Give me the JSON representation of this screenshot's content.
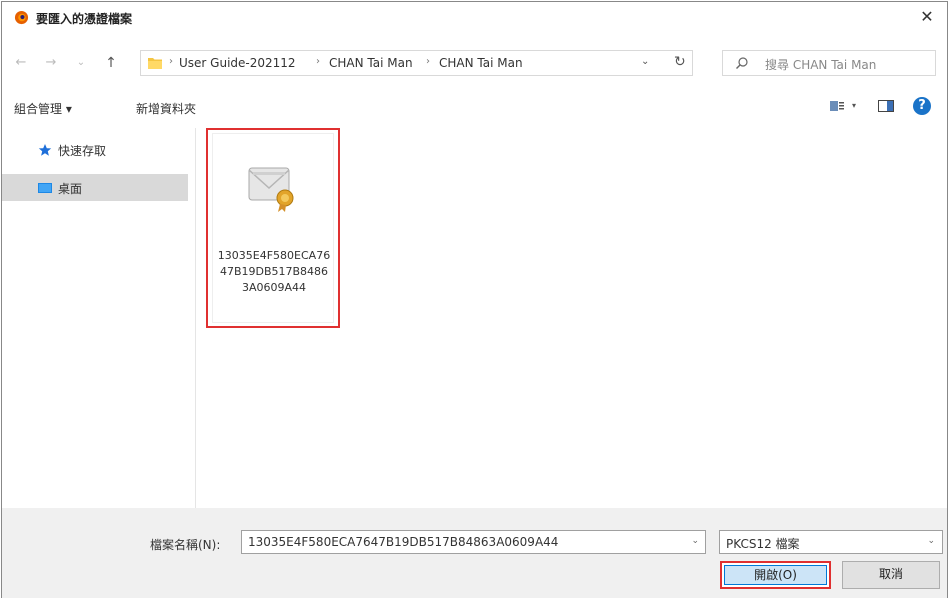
{
  "window": {
    "title": "要匯入的憑證檔案",
    "close_glyph": "✕"
  },
  "nav": {
    "back_glyph": "←",
    "forward_glyph": "→",
    "recent_glyph": "⌄",
    "up_glyph": "↑",
    "breadcrumbs": [
      "User Guide-202112",
      "CHAN Tai Man",
      "CHAN Tai Man"
    ],
    "separator": "›",
    "address_dropdown_glyph": "⌄",
    "refresh_glyph": "↻",
    "search_placeholder": "搜尋 CHAN Tai Man"
  },
  "toolbar": {
    "organize_label": "組合管理 ▾",
    "new_folder_label": "新增資料夾",
    "view_dropdown_glyph": "▾",
    "help_glyph": "?"
  },
  "sidebar": {
    "items": [
      {
        "label": "快速存取",
        "icon": "star-icon"
      },
      {
        "label": "桌面",
        "icon": "desktop-icon"
      }
    ]
  },
  "files": [
    {
      "name": "13035E4F580ECA7647B19DB517B84863A0609A44",
      "icon": "certificate-icon"
    }
  ],
  "bottom": {
    "filename_label": "檔案名稱(N):",
    "filename_value": "13035E4F580ECA7647B19DB517B84863A0609A44",
    "filetype_value": "PKCS12 檔案",
    "open_label": "開啟(O)",
    "cancel_label": "取消"
  },
  "colors": {
    "highlight": "#e03030",
    "selection": "#d9d9d9",
    "accent": "#0078d7"
  }
}
